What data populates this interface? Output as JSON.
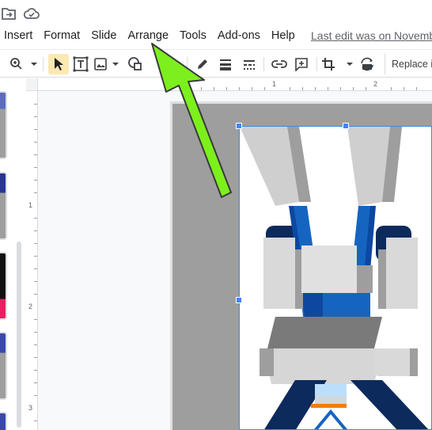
{
  "menubar": {
    "items": [
      "Insert",
      "Format",
      "Slide",
      "Arrange",
      "Tools",
      "Add-ons",
      "Help"
    ],
    "last_edit": "Last edit was on Novemb"
  },
  "toolbar": {
    "replace_label": "Replace in"
  },
  "ruler": {
    "h_numbers": [
      "1",
      "2"
    ],
    "v_numbers": [
      "1",
      "2",
      "3"
    ]
  },
  "colors": {
    "accent_selection": "#4285f4",
    "annotation_arrow": "#7cf01c",
    "tool_selected_bg": "#fce8b2"
  },
  "icons": {
    "status": [
      "move-to-folder-icon",
      "cloud-saved-icon"
    ],
    "toolbar": [
      "zoom-icon",
      "select-cursor-icon",
      "text-box-icon",
      "image-icon",
      "shape-icon",
      "pen-icon",
      "line-weight-icon",
      "line-dash-icon",
      "link-icon",
      "comment-icon",
      "crop-icon",
      "replace-image-icon"
    ]
  }
}
